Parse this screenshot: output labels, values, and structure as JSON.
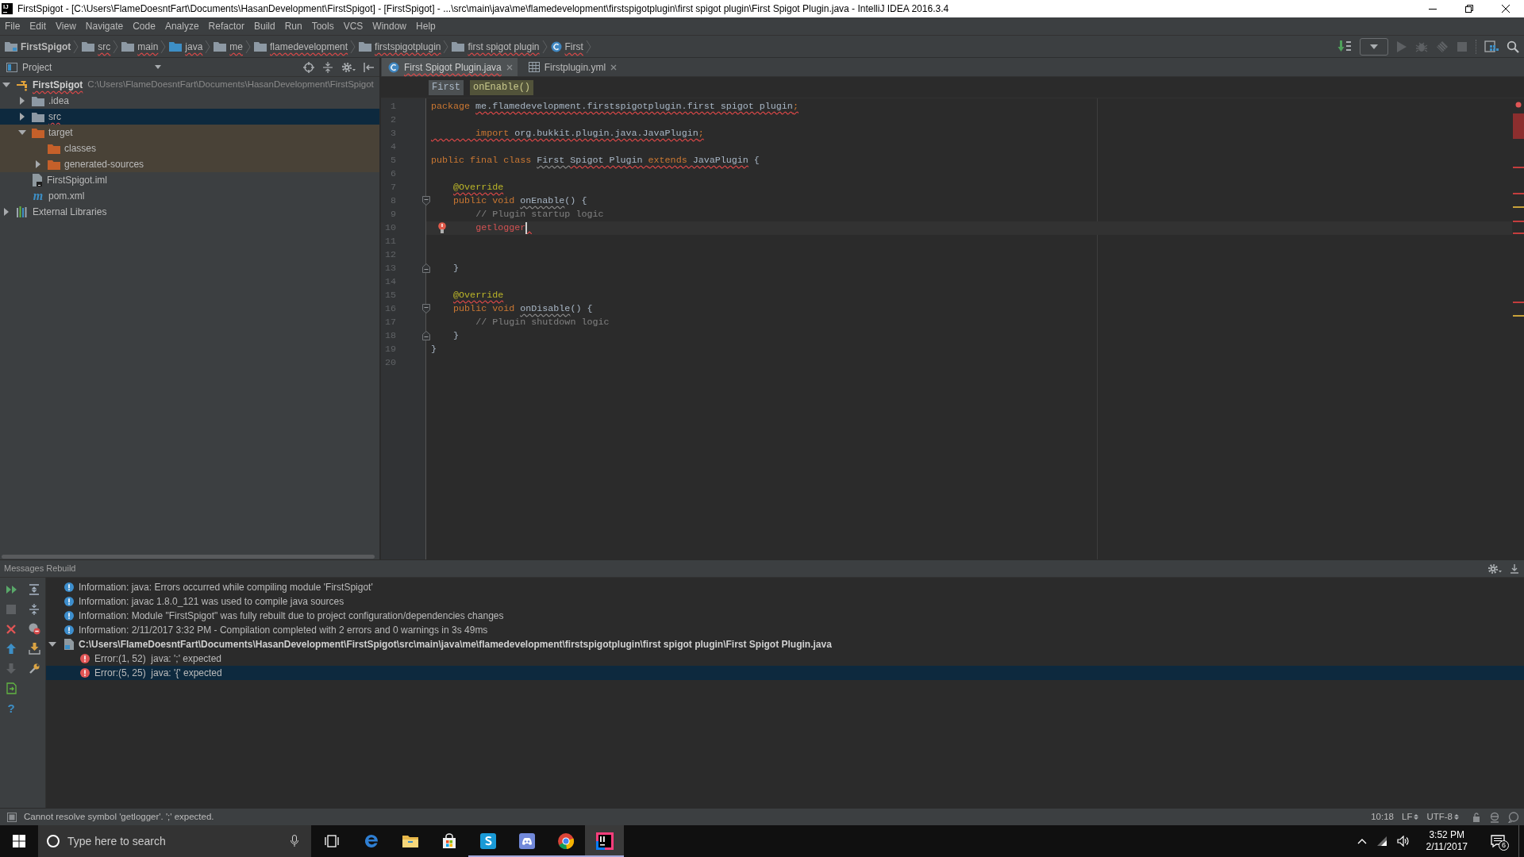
{
  "window": {
    "logo": "IJ",
    "title": "FirstSpigot - [C:\\Users\\FlameDoesntFart\\Documents\\HasanDevelopment\\FirstSpigot] - [FirstSpigot] - ...\\src\\main\\java\\me\\flamedevelopment\\firstspigotplugin\\first spigot plugin\\First Spigot Plugin.java - IntelliJ IDEA 2016.3.4",
    "controls": [
      {
        "kind": "minimize"
      },
      {
        "kind": "restore"
      },
      {
        "kind": "close"
      }
    ]
  },
  "menu": [
    "File",
    "Edit",
    "View",
    "Navigate",
    "Code",
    "Analyze",
    "Refactor",
    "Build",
    "Run",
    "Tools",
    "VCS",
    "Window",
    "Help"
  ],
  "navigation_bar": {
    "breadcrumbs": [
      {
        "label": "FirstSpigot",
        "kind": "module",
        "error": false
      },
      {
        "label": "src",
        "kind": "folder",
        "error": true
      },
      {
        "label": "main",
        "kind": "folder",
        "error": true
      },
      {
        "label": "java",
        "kind": "source_folder",
        "error": true
      },
      {
        "label": "me",
        "kind": "folder",
        "error": true
      },
      {
        "label": "flamedevelopment",
        "kind": "folder",
        "error": true
      },
      {
        "label": "firstspigotplugin",
        "kind": "folder",
        "error": true
      },
      {
        "label": "first spigot plugin",
        "kind": "folder",
        "error": true
      },
      {
        "label": "First",
        "kind": "class",
        "error": true
      }
    ],
    "toolbar": [
      {
        "kind": "build",
        "disabled": false
      },
      {
        "kind": "run_configurations",
        "disabled": false
      },
      {
        "kind": "run",
        "disabled": true
      },
      {
        "kind": "debug",
        "disabled": true
      },
      {
        "kind": "coverage",
        "disabled": true
      },
      {
        "kind": "stop",
        "disabled": true
      },
      {
        "kind": "project_structure",
        "disabled": false
      },
      {
        "kind": "search",
        "disabled": false
      }
    ]
  },
  "project_panel": {
    "title": "Project",
    "tools": [
      {
        "kind": "scroll_from_source"
      },
      {
        "kind": "collapse_all"
      },
      {
        "kind": "settings"
      },
      {
        "kind": "hide"
      }
    ],
    "tree": [
      {
        "label": "FirstSpigot",
        "path": "C:\\Users\\FlameDoesntFart\\Documents\\HasanDevelopment\\FirstSpigot",
        "kind": "module",
        "expanded": true,
        "selected": false,
        "error": true,
        "children": [
          {
            "label": ".idea",
            "kind": "folder",
            "expanded": false,
            "selected": false,
            "error": false
          },
          {
            "label": "src",
            "kind": "folder",
            "expanded": false,
            "selected": true,
            "error": true
          },
          {
            "label": "target",
            "kind": "excluded_folder",
            "expanded": true,
            "selected": false,
            "error": false,
            "children": [
              {
                "label": "classes",
                "kind": "excluded_folder",
                "selected": false,
                "error": false
              },
              {
                "label": "generated-sources",
                "kind": "excluded_folder",
                "expanded": false,
                "selected": false,
                "error": false
              }
            ]
          },
          {
            "label": "FirstSpigot.iml",
            "kind": "iml_file",
            "selected": false,
            "error": false
          },
          {
            "label": "pom.xml",
            "kind": "maven_file",
            "icon": "m",
            "selected": false,
            "error": false
          }
        ]
      },
      {
        "label": "External Libraries",
        "kind": "libraries",
        "expanded": false,
        "selected": false,
        "error": false
      }
    ]
  },
  "editor": {
    "tabs": [
      {
        "label": "First Spigot Plugin.java",
        "kind": "class",
        "selected": true,
        "error": true
      },
      {
        "label": "Firstplugin.yml",
        "kind": "yml",
        "selected": false,
        "error": false
      }
    ],
    "breadcrumbs": [
      {
        "label": "First",
        "selected": false
      },
      {
        "label": "onEnable()",
        "selected": true
      }
    ],
    "lines": [
      {
        "number": "1",
        "current": false,
        "tokens": [
          {
            "text": "package ",
            "kind": "keyword",
            "error": false
          },
          {
            "text": "me.flamedevelopment.firstspigotplugin.first spigot plugin",
            "kind": "plain",
            "error": true
          },
          {
            "text": ";",
            "kind": "keyword",
            "error": true
          }
        ]
      },
      {
        "number": "2",
        "current": false
      },
      {
        "number": "3",
        "current": false,
        "tokens": [
          {
            "text": "        import ",
            "kind": "keyword",
            "error": true
          },
          {
            "text": "org.bukkit.plugin.java.JavaPlugin",
            "kind": "plain",
            "error": true
          },
          {
            "text": ";",
            "kind": "keyword",
            "error": true
          }
        ]
      },
      {
        "number": "4",
        "current": false
      },
      {
        "number": "5",
        "current": false,
        "tokens": [
          {
            "text": "public final class ",
            "kind": "keyword",
            "error": false
          },
          {
            "text": "First ",
            "kind": "unused",
            "error": false
          },
          {
            "text": "Spigot Plugin ",
            "kind": "plain",
            "error": true
          },
          {
            "text": "extends ",
            "kind": "keyword",
            "error": true
          },
          {
            "text": "JavaPlugin",
            "kind": "plain",
            "error": true
          },
          {
            "text": " {",
            "kind": "plain",
            "error": false
          }
        ],
        "children": [
          {
            "number": "6",
            "current": false
          },
          {
            "number": "7",
            "current": false,
            "tokens": [
              {
                "text": "@Override",
                "kind": "annotation",
                "error": true
              }
            ]
          },
          {
            "number": "8",
            "current": false,
            "fold_start": true,
            "tokens": [
              {
                "text": "public void ",
                "kind": "keyword",
                "error": false
              },
              {
                "text": "onEnable",
                "kind": "unused",
                "error": false
              },
              {
                "text": "() {",
                "kind": "plain",
                "error": false
              }
            ],
            "children": [
              {
                "number": "9",
                "current": false,
                "tokens": [
                  {
                    "text": "// Plugin startup logic",
                    "kind": "comment",
                    "error": false
                  }
                ]
              },
              {
                "number": "10",
                "current": true,
                "bulb": true,
                "caret_error": true,
                "tokens": [
                  {
                    "text": "getlogger",
                    "kind": "unresolved",
                    "error": false
                  }
                ]
              },
              {
                "number": "11",
                "current": false
              },
              {
                "number": "12",
                "current": false
              }
            ]
          },
          {
            "number": "13",
            "current": false,
            "fold_end": true,
            "tokens": [
              {
                "text": "}",
                "kind": "plain",
                "error": false
              }
            ]
          },
          {
            "number": "14",
            "current": false
          },
          {
            "number": "15",
            "current": false,
            "tokens": [
              {
                "text": "@Override",
                "kind": "annotation",
                "error": true
              }
            ]
          },
          {
            "number": "16",
            "current": false,
            "fold_start": true,
            "tokens": [
              {
                "text": "public void ",
                "kind": "keyword",
                "error": false
              },
              {
                "text": "onDisable",
                "kind": "unused",
                "error": false
              },
              {
                "text": "() {",
                "kind": "plain",
                "error": false
              }
            ],
            "children": [
              {
                "number": "17",
                "current": false,
                "tokens": [
                  {
                    "text": "// Plugin shutdown logic",
                    "kind": "comment",
                    "error": false
                  }
                ]
              }
            ]
          },
          {
            "number": "18",
            "current": false,
            "fold_end": true,
            "tokens": [
              {
                "text": "}",
                "kind": "plain",
                "error": false
              }
            ]
          }
        ]
      },
      {
        "number": "19",
        "current": false,
        "tokens": [
          {
            "text": "}",
            "kind": "plain",
            "error": false
          }
        ]
      },
      {
        "number": "20",
        "current": false
      }
    ]
  },
  "messages_panel": {
    "title": "Messages Rebuild",
    "header_tools": [
      {
        "kind": "settings"
      },
      {
        "kind": "hide"
      }
    ],
    "toolbar": {
      "column_1": [
        {
          "kind": "rerun",
          "disabled": false
        },
        {
          "kind": "stop",
          "disabled": true
        },
        {
          "kind": "close",
          "disabled": false
        },
        {
          "kind": "previous",
          "disabled": false
        },
        {
          "kind": "next",
          "disabled": true
        },
        {
          "kind": "export",
          "disabled": false
        },
        {
          "kind": "help",
          "label": "?",
          "disabled": false
        }
      ],
      "column_2": [
        {
          "kind": "expand_all",
          "disabled": false
        },
        {
          "kind": "collapse_all",
          "disabled": false
        },
        {
          "kind": "hide_warnings",
          "disabled": false
        },
        {
          "kind": "export_to_file",
          "disabled": false
        },
        {
          "kind": "settings",
          "disabled": false
        }
      ]
    },
    "messages": [
      {
        "kind": "info",
        "text": "Information: java: Errors occurred while compiling module 'FirstSpigot'",
        "selected": false
      },
      {
        "kind": "info",
        "text": "Information: javac 1.8.0_121 was used to compile java sources",
        "selected": false
      },
      {
        "kind": "info",
        "text": "Information: Module \"FirstSpigot\" was fully rebuilt due to project configuration/dependencies changes",
        "selected": false
      },
      {
        "kind": "info",
        "text": "Information: 2/11/2017 3:32 PM - Compilation completed with 2 errors and 0 warnings in 3s 49ms",
        "selected": false
      },
      {
        "kind": "file",
        "text": "C:\\Users\\FlameDoesntFart\\Documents\\HasanDevelopment\\FirstSpigot\\src\\main\\java\\me\\flamedevelopment\\firstspigotplugin\\first spigot plugin\\First Spigot Plugin.java",
        "expanded": true,
        "selected": false,
        "children": [
          {
            "kind": "error",
            "text": "Error:(1, 52)  java: ';' expected",
            "selected": false
          },
          {
            "kind": "error",
            "text": "Error:(5, 25)  java: '{' expected",
            "selected": true
          }
        ]
      }
    ]
  },
  "status_bar": {
    "message": "Cannot resolve symbol 'getlogger'. ';' expected.",
    "position": "10:18",
    "line_separator": "LF",
    "encoding": "UTF-8",
    "indicators": [
      {
        "kind": "lock"
      },
      {
        "kind": "inspection"
      },
      {
        "kind": "event_log"
      }
    ]
  },
  "taskbar": {
    "search": {
      "placeholder": "Type here to search"
    },
    "apps": [
      {
        "kind": "task_view",
        "running": false,
        "selected": false
      },
      {
        "kind": "edge",
        "running": false,
        "selected": false
      },
      {
        "kind": "explorer",
        "running": false,
        "selected": false
      },
      {
        "kind": "store",
        "running": false,
        "selected": false
      },
      {
        "kind": "skype",
        "running": true,
        "selected": false
      },
      {
        "kind": "discord",
        "running": true,
        "selected": false
      },
      {
        "kind": "chrome",
        "running": true,
        "selected": false
      },
      {
        "kind": "intellij",
        "running": true,
        "selected": true
      }
    ],
    "tray": [
      {
        "kind": "overflow"
      },
      {
        "kind": "network"
      },
      {
        "kind": "volume"
      }
    ],
    "clock": {
      "time": "3:52 PM",
      "date": "2/11/2017"
    },
    "notifications": {
      "count": "6"
    }
  }
}
